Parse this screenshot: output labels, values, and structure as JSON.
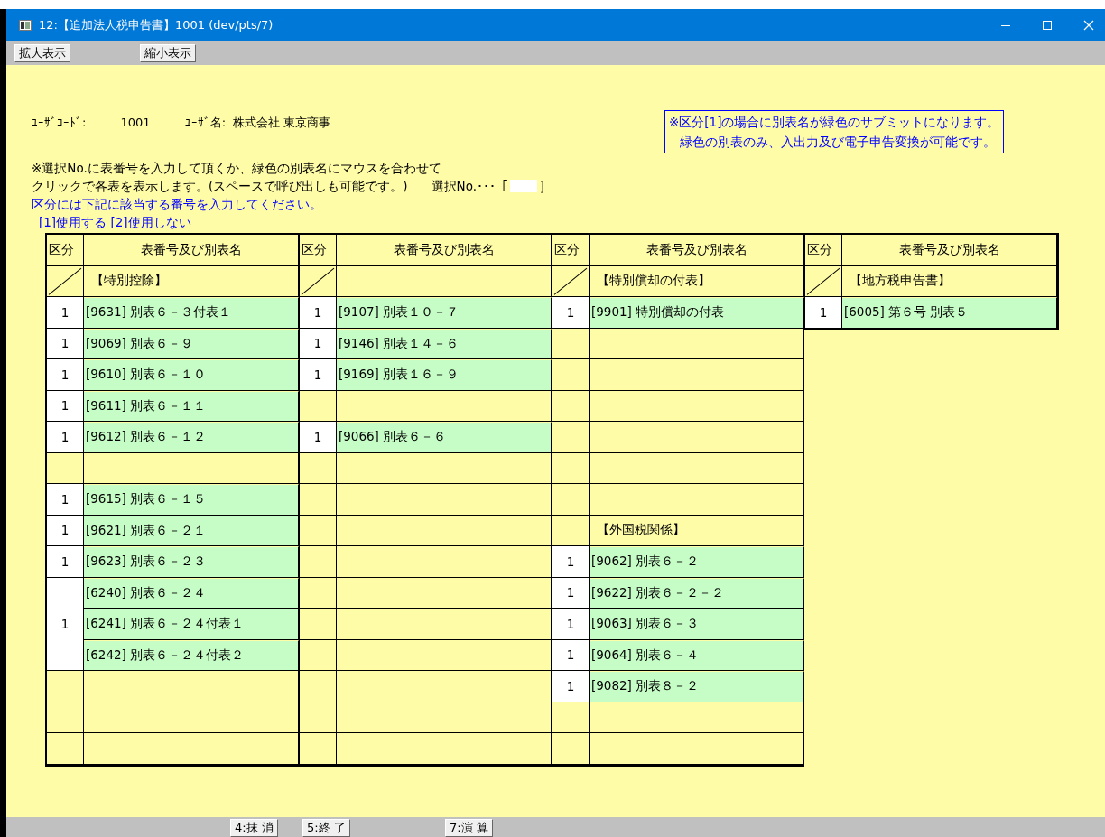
{
  "window": {
    "title": "12:【追加法人税申告書】1001 (dev/pts/7)"
  },
  "toolbar": [
    "拡大表示",
    "縮小表示"
  ],
  "user": {
    "code_label": "ﾕｰｻﾞｺｰﾄﾞ:",
    "code": "1001",
    "name_label": "ﾕｰｻﾞ名:",
    "name": "株式会社 東京商事"
  },
  "notice": [
    "※区分[1]の場合に別表名が緑色のサブミットになります。",
    "緑色の別表のみ、入出力及び電子申告変換が可能です。"
  ],
  "instructions": [
    "※選択No.に表番号を入力して頂くか、緑色の別表名にマウスを合わせて",
    "クリックで各表を表示します。(スペースで呼び出しも可能です。)"
  ],
  "select": {
    "label": "選択No.･･･［",
    "close": "］"
  },
  "hints": [
    "区分には下記に該当する番号を入力してください。",
    "[1]使用する [2]使用しない"
  ],
  "groups": [
    {
      "kubun_header": "区分",
      "name_header": "表番号及び別表名",
      "section": "【特別控除】",
      "rows": [
        {
          "kind": "entry",
          "kubun": "1",
          "names": [
            "[9631] 別表６－３付表１"
          ]
        },
        {
          "kind": "entry",
          "kubun": "1",
          "names": [
            "[9069] 別表６－９"
          ]
        },
        {
          "kind": "entry",
          "kubun": "1",
          "names": [
            "[9610] 別表６－１０"
          ]
        },
        {
          "kind": "entry",
          "kubun": "1",
          "names": [
            "[9611] 別表６－１１"
          ]
        },
        {
          "kind": "entry",
          "kubun": "1",
          "names": [
            "[9612] 別表６－１２"
          ]
        },
        {
          "kind": "blank"
        },
        {
          "kind": "entry",
          "kubun": "1",
          "names": [
            "[9615] 別表６－１５"
          ]
        },
        {
          "kind": "entry",
          "kubun": "1",
          "names": [
            "[9621] 別表６－２１"
          ]
        },
        {
          "kind": "entry",
          "kubun": "1",
          "names": [
            "[9623] 別表６－２３"
          ]
        },
        {
          "kind": "entry",
          "kubun": "1",
          "names": [
            "[6240] 別表６－２４",
            "[6241] 別表６－２４付表１",
            "[6242] 別表６－２４付表２"
          ]
        },
        {
          "kind": "blank"
        },
        {
          "kind": "blank"
        },
        {
          "kind": "blank"
        }
      ]
    },
    {
      "kubun_header": "区分",
      "name_header": "表番号及び別表名",
      "rows": [
        {
          "kind": "entry",
          "kubun": "1",
          "names": [
            "[9107] 別表１０－７"
          ]
        },
        {
          "kind": "entry",
          "kubun": "1",
          "names": [
            "[9146] 別表１４－６"
          ]
        },
        {
          "kind": "entry",
          "kubun": "1",
          "names": [
            "[9169] 別表１６－９"
          ]
        },
        {
          "kind": "blank"
        },
        {
          "kind": "entry",
          "kubun": "1",
          "names": [
            "[9066] 別表６－６"
          ]
        },
        {
          "kind": "blank"
        },
        {
          "kind": "blank"
        },
        {
          "kind": "blank"
        },
        {
          "kind": "blank"
        },
        {
          "kind": "blank"
        },
        {
          "kind": "blank"
        },
        {
          "kind": "blank"
        },
        {
          "kind": "blank"
        },
        {
          "kind": "blank"
        },
        {
          "kind": "blank"
        }
      ]
    },
    {
      "kubun_header": "区分",
      "name_header": "表番号及び別表名",
      "section": "【特別償却の付表】",
      "rows": [
        {
          "kind": "entry",
          "kubun": "1",
          "names": [
            "[9901] 特別償却の付表"
          ]
        },
        {
          "kind": "blank"
        },
        {
          "kind": "blank"
        },
        {
          "kind": "blank"
        },
        {
          "kind": "blank"
        },
        {
          "kind": "blank"
        },
        {
          "kind": "blank"
        },
        {
          "kind": "heading",
          "label": "【外国税関係】"
        },
        {
          "kind": "entry",
          "kubun": "1",
          "names": [
            "[9062] 別表６－２"
          ]
        },
        {
          "kind": "entry",
          "kubun": "1",
          "names": [
            "[9622] 別表６－２－２"
          ]
        },
        {
          "kind": "entry",
          "kubun": "1",
          "names": [
            "[9063] 別表６－３"
          ]
        },
        {
          "kind": "entry",
          "kubun": "1",
          "names": [
            "[9064] 別表６－４"
          ]
        },
        {
          "kind": "entry",
          "kubun": "1",
          "names": [
            "[9082] 別表８－２"
          ]
        },
        {
          "kind": "blank"
        },
        {
          "kind": "blank"
        }
      ]
    },
    {
      "kubun_header": "区分",
      "name_header": "表番号及び別表名",
      "section": "【地方税申告書】",
      "rows": [
        {
          "kind": "entry",
          "kubun": "1",
          "names": [
            "[6005] 第６号 別表５"
          ]
        }
      ]
    }
  ],
  "function_keys": [
    "4:抹 消",
    "5:終 了",
    "7:演 算"
  ]
}
